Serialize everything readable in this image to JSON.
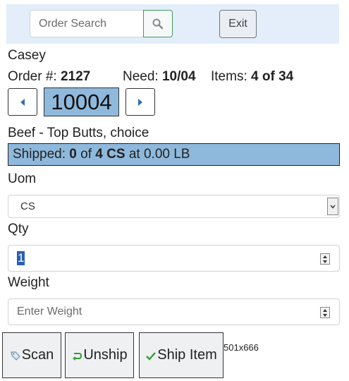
{
  "header": {
    "search_placeholder": "Order Search",
    "search_icon": "magnifier-icon",
    "exit_label": "Exit"
  },
  "order": {
    "customer": "Casey",
    "order_label": "Order #:",
    "order_number": "2127",
    "need_label": "Need:",
    "need_date": "10/04",
    "items_label": "Items:",
    "items_value": "4 of 34"
  },
  "item": {
    "code": "10004",
    "description": "Beef - Top Butts, choice",
    "shipped_label": "Shipped:",
    "shipped_qty": "0",
    "of_text": "of",
    "ordered_qty": "4 CS",
    "at_text": "at",
    "weight_text": "0.00 LB"
  },
  "form": {
    "uom_label": "Uom",
    "uom_value": "CS",
    "qty_label": "Qty",
    "qty_value": "1",
    "weight_label": "Weight",
    "weight_placeholder": "Enter Weight"
  },
  "actions": {
    "scan_label": "Scan",
    "unship_label": "Unship",
    "ship_label": "Ship Item"
  },
  "screen_size_text": "501x666",
  "colors": {
    "header_bg": "#e3eefa",
    "highlight": "#8fb9dc",
    "search_border": "#3d9a5b",
    "unship_icon": "#3a9a3a",
    "ship_icon": "#3a9a3a"
  }
}
